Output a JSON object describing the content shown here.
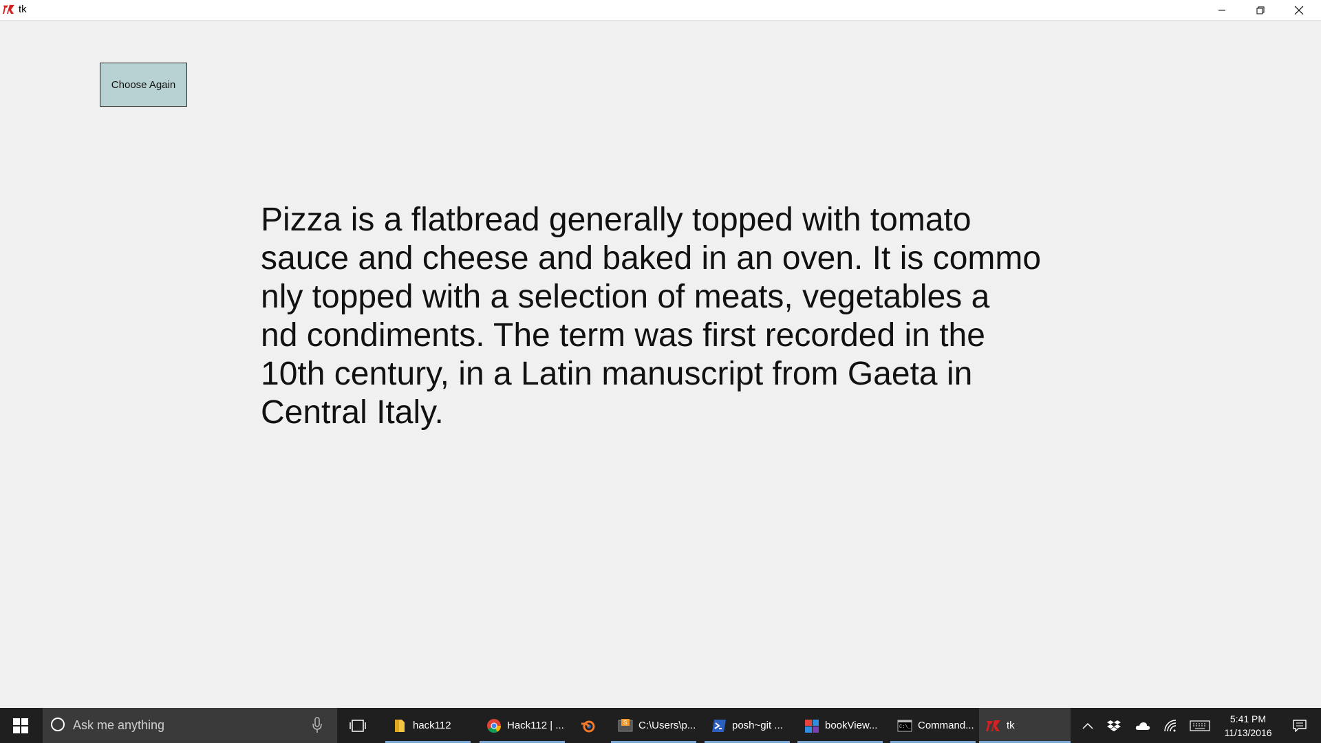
{
  "window": {
    "title": "tk",
    "minimize_icon": "minimize-icon",
    "maximize_icon": "restore-icon",
    "close_icon": "close-icon"
  },
  "app": {
    "choose_again_label": "Choose Again",
    "description_lines": [
      "Pizza is a flatbread generally topped with tomato",
      "sauce and cheese and baked in an oven. It is commo",
      "nly topped with a selection of meats, vegetables a",
      "nd condiments. The term was first recorded in the",
      "10th century, in a Latin manuscript from Gaeta in",
      "Central Italy."
    ],
    "button_color": "#b8d1d3"
  },
  "taskbar": {
    "search_placeholder": "Ask me anything",
    "items": [
      {
        "label": "hack112",
        "icon": "folder-icon"
      },
      {
        "label": "Hack112 | ...",
        "icon": "chrome-icon"
      },
      {
        "label": "",
        "icon": "blender-icon"
      },
      {
        "label": "C:\\Users\\p...",
        "icon": "sublime-icon"
      },
      {
        "label": "posh~git ...",
        "icon": "powershell-icon"
      },
      {
        "label": "bookView...",
        "icon": "app-icon"
      },
      {
        "label": "Command...",
        "icon": "cmd-icon"
      },
      {
        "label": "tk",
        "icon": "tk-icon"
      }
    ],
    "clock_time": "5:41 PM",
    "clock_date": "11/13/2016"
  }
}
